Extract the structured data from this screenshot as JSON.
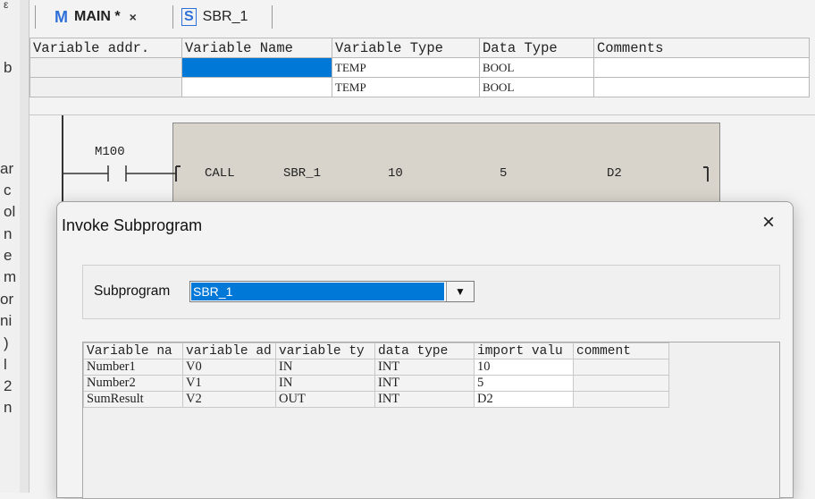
{
  "left_panel": {
    "glyphs": [
      "ε",
      "b",
      "ar",
      "c",
      "ol",
      "n",
      "e",
      "m",
      "or",
      "ni",
      ")",
      "l",
      "2",
      "n"
    ]
  },
  "tabs": [
    {
      "icon": "M",
      "label": "MAIN *",
      "close": "×"
    },
    {
      "icon": "S",
      "label": "SBR_1"
    }
  ],
  "variable_table": {
    "headers": [
      "Variable addr.",
      "Variable Name",
      "Variable Type",
      "Data Type",
      "Comments"
    ],
    "rows": [
      {
        "addr": "",
        "name": "",
        "type": "TEMP",
        "data_type": "BOOL",
        "comments": ""
      },
      {
        "addr": "",
        "name": "",
        "type": "TEMP",
        "data_type": "BOOL",
        "comments": ""
      }
    ]
  },
  "ladder": {
    "contact": "M100",
    "call": {
      "instr": "CALL",
      "target": "SBR_1",
      "arg1": "10",
      "arg2": "5",
      "arg3": "D2"
    }
  },
  "dialog": {
    "title": "Invoke Subprogram",
    "close": "×",
    "subprogram_label": "Subprogram",
    "subprogram_value": "SBR_1",
    "dropdown_arrow": "▼",
    "grid_headers": [
      "Variable na",
      "variable ad",
      "variable ty",
      "data type",
      "import valu",
      "comment"
    ],
    "grid_rows": [
      {
        "name": "Number1",
        "addr": "V0",
        "vtype": "IN",
        "dtype": "INT",
        "value": "10",
        "comment": ""
      },
      {
        "name": "Number2",
        "addr": "V1",
        "vtype": "IN",
        "dtype": "INT",
        "value": "5",
        "comment": ""
      },
      {
        "name": "SumResult",
        "addr": "V2",
        "vtype": "OUT",
        "dtype": "INT",
        "value": "D2",
        "comment": ""
      }
    ]
  },
  "colors": {
    "accent": "#0078d7",
    "tab_icon": "#2e6fd8",
    "call_box": "#d9d4cb"
  }
}
